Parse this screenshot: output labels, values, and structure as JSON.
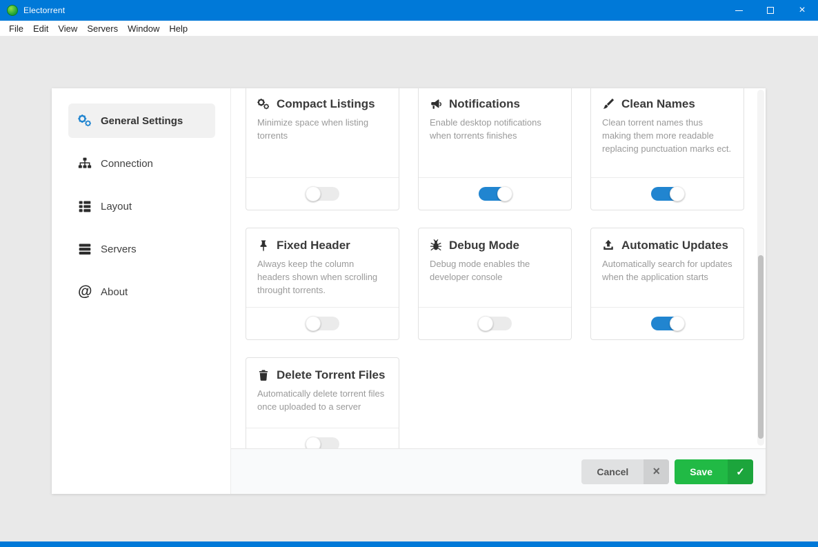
{
  "window": {
    "title": "Electorrent",
    "controls": {
      "minimize": "minimize",
      "maximize": "maximize",
      "close": "×"
    }
  },
  "menubar": {
    "items": [
      {
        "label": "File"
      },
      {
        "label": "Edit"
      },
      {
        "label": "View"
      },
      {
        "label": "Servers"
      },
      {
        "label": "Window"
      },
      {
        "label": "Help"
      }
    ]
  },
  "sidebar": {
    "items": [
      {
        "label": "General Settings",
        "icon": "cogs-icon",
        "active": true
      },
      {
        "label": "Connection",
        "icon": "sitemap-icon",
        "active": false
      },
      {
        "label": "Layout",
        "icon": "layout-list-icon",
        "active": false
      },
      {
        "label": "Servers",
        "icon": "server-icon",
        "active": false
      },
      {
        "label": "About",
        "icon": "at-icon",
        "active": false
      }
    ]
  },
  "settings": {
    "cards": [
      {
        "title": "Compact Listings",
        "icon": "cogs-icon",
        "description": "Minimize space when listing torrents",
        "enabled": false
      },
      {
        "title": "Notifications",
        "icon": "bullhorn-icon",
        "description": "Enable desktop notifications when torrents finishes",
        "enabled": true
      },
      {
        "title": "Clean Names",
        "icon": "paint-brush-icon",
        "description": "Clean torrent names thus making them more readable replacing punctuation marks ect.",
        "enabled": true
      },
      {
        "title": "Fixed Header",
        "icon": "pin-icon",
        "description": "Always keep the column headers shown when scrolling throught torrents.",
        "enabled": false
      },
      {
        "title": "Debug Mode",
        "icon": "bug-icon",
        "description": "Debug mode enables the developer console",
        "enabled": false
      },
      {
        "title": "Automatic Updates",
        "icon": "upload-icon",
        "description": "Automatically search for updates when the application starts",
        "enabled": true
      },
      {
        "title": "Delete Torrent Files",
        "icon": "trash-icon",
        "description": "Automatically delete torrent files once uploaded to a server",
        "enabled": false
      }
    ]
  },
  "footer": {
    "cancel_label": "Cancel",
    "cancel_icon": "close-icon",
    "cancel_glyph": "×",
    "save_label": "Save",
    "save_icon": "check-icon",
    "save_glyph": "✓"
  },
  "colors": {
    "titlebar_blue": "#0079d8",
    "accent_blue": "#2185d0",
    "save_green": "#21ba45",
    "workspace_gray": "#e9e9e9"
  }
}
